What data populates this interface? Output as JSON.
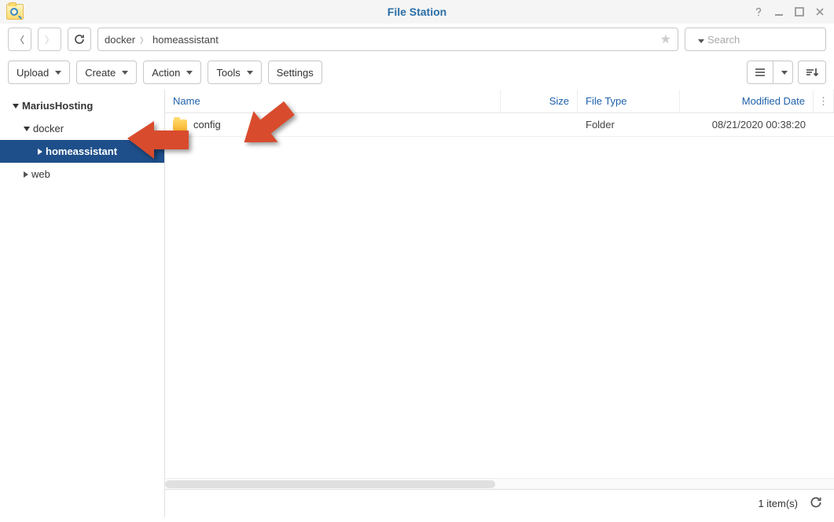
{
  "window": {
    "title": "File Station"
  },
  "nav": {
    "breadcrumb": [
      "docker",
      "homeassistant"
    ]
  },
  "search": {
    "placeholder": "Search"
  },
  "toolbar": {
    "upload_label": "Upload",
    "create_label": "Create",
    "action_label": "Action",
    "tools_label": "Tools",
    "settings_label": "Settings"
  },
  "sidebar": {
    "root": "MariusHosting",
    "items": [
      {
        "label": "docker",
        "level": 2,
        "expanded": true
      },
      {
        "label": "homeassistant",
        "level": 3,
        "selected": true,
        "collapsed": true
      },
      {
        "label": "web",
        "level": 2,
        "collapsed": true
      }
    ]
  },
  "columns": {
    "name": "Name",
    "size": "Size",
    "type": "File Type",
    "date": "Modified Date"
  },
  "rows": [
    {
      "name": "config",
      "size": "",
      "type": "Folder",
      "date": "08/21/2020 00:38:20",
      "icon": "folder"
    }
  ],
  "status": {
    "count_text": "1 item(s)"
  }
}
